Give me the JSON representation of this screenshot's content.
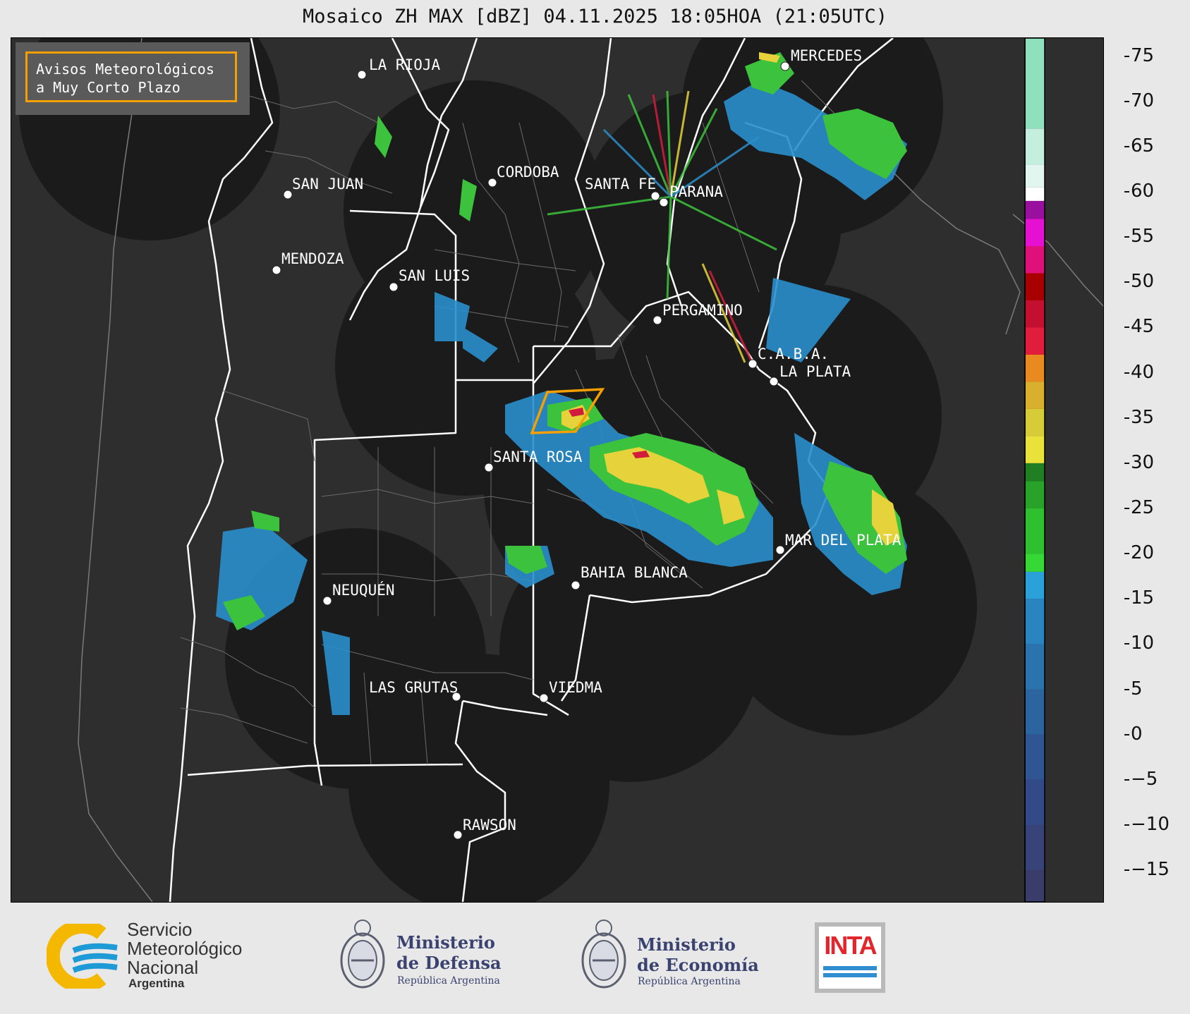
{
  "title": "Mosaico ZH MAX [dBZ] 04.11.2025 18:05HOA (21:05UTC)",
  "warning_box": {
    "line1": "Avisos Meteorológicos",
    "line2": "a Muy Corto Plazo",
    "border_color": "#f5a000"
  },
  "cities": [
    {
      "name": "LA RIOJA"
    },
    {
      "name": "MERCEDES"
    },
    {
      "name": "SAN JUAN"
    },
    {
      "name": "CORDOBA"
    },
    {
      "name": "SANTA FE"
    },
    {
      "name": "PARANA"
    },
    {
      "name": "MENDOZA"
    },
    {
      "name": "SAN LUIS"
    },
    {
      "name": "PERGAMINO"
    },
    {
      "name": "C.A.B.A."
    },
    {
      "name": "LA PLATA"
    },
    {
      "name": "SANTA ROSA"
    },
    {
      "name": "MAR DEL PLATA"
    },
    {
      "name": "BAHIA BLANCA"
    },
    {
      "name": "NEUQUÉN"
    },
    {
      "name": "LAS GRUTAS"
    },
    {
      "name": "VIEDMA"
    },
    {
      "name": "RAWSON"
    }
  ],
  "colorbar": {
    "unit": "dBZ",
    "ticks": [
      "75",
      "70",
      "65",
      "60",
      "55",
      "50",
      "45",
      "40",
      "35",
      "30",
      "25",
      "20",
      "15",
      "10",
      "5",
      "0",
      "−5",
      "−10",
      "−15"
    ],
    "min": -18.5,
    "max": 77
  },
  "logos": {
    "smn_line1": "Servicio",
    "smn_line2": "Meteorológico",
    "smn_line3": "Nacional",
    "smn_line4": "Argentina",
    "defensa_line1": "Ministerio",
    "defensa_line2": "de Defensa",
    "defensa_line3": "República Argentina",
    "economia_line1": "Ministerio",
    "economia_line2": "de Economía",
    "economia_line3": "República Argentina",
    "inta": "INTA"
  },
  "colors": {
    "map_background": "#2e2e2e",
    "radar_coverage": "#1b1b1b",
    "warning_polygon": "#f5a000"
  }
}
